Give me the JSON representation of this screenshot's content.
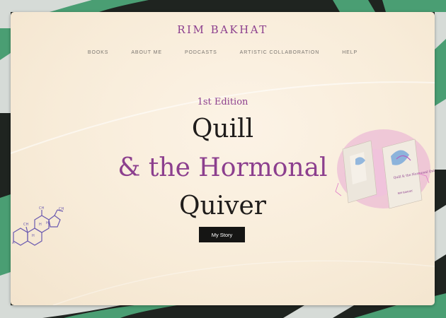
{
  "site": {
    "brand": "RIM BAKHAT"
  },
  "nav": {
    "items": [
      {
        "label": "BOOKS"
      },
      {
        "label": "ABOUT ME"
      },
      {
        "label": "PODCASTS"
      },
      {
        "label": "ARTISTIC COLLABORATION"
      },
      {
        "label": "HELP"
      }
    ]
  },
  "hero": {
    "edition": "1st Edition",
    "title_line_1": "Quill",
    "title_line_2": "& the Hormonal",
    "title_line_3": "Quiver",
    "cta_label": "My Story"
  },
  "book": {
    "cover_title": "Quill & the Hormonal Quiver",
    "cover_author": "RIM BAKHAT"
  },
  "colors": {
    "accent": "#8c3f8e",
    "page_background": "#fbf1e3",
    "frame_dark": "#1f2420",
    "frame_green": "#4a9e73",
    "frame_light": "#d6dbd7",
    "button": "#151514"
  }
}
